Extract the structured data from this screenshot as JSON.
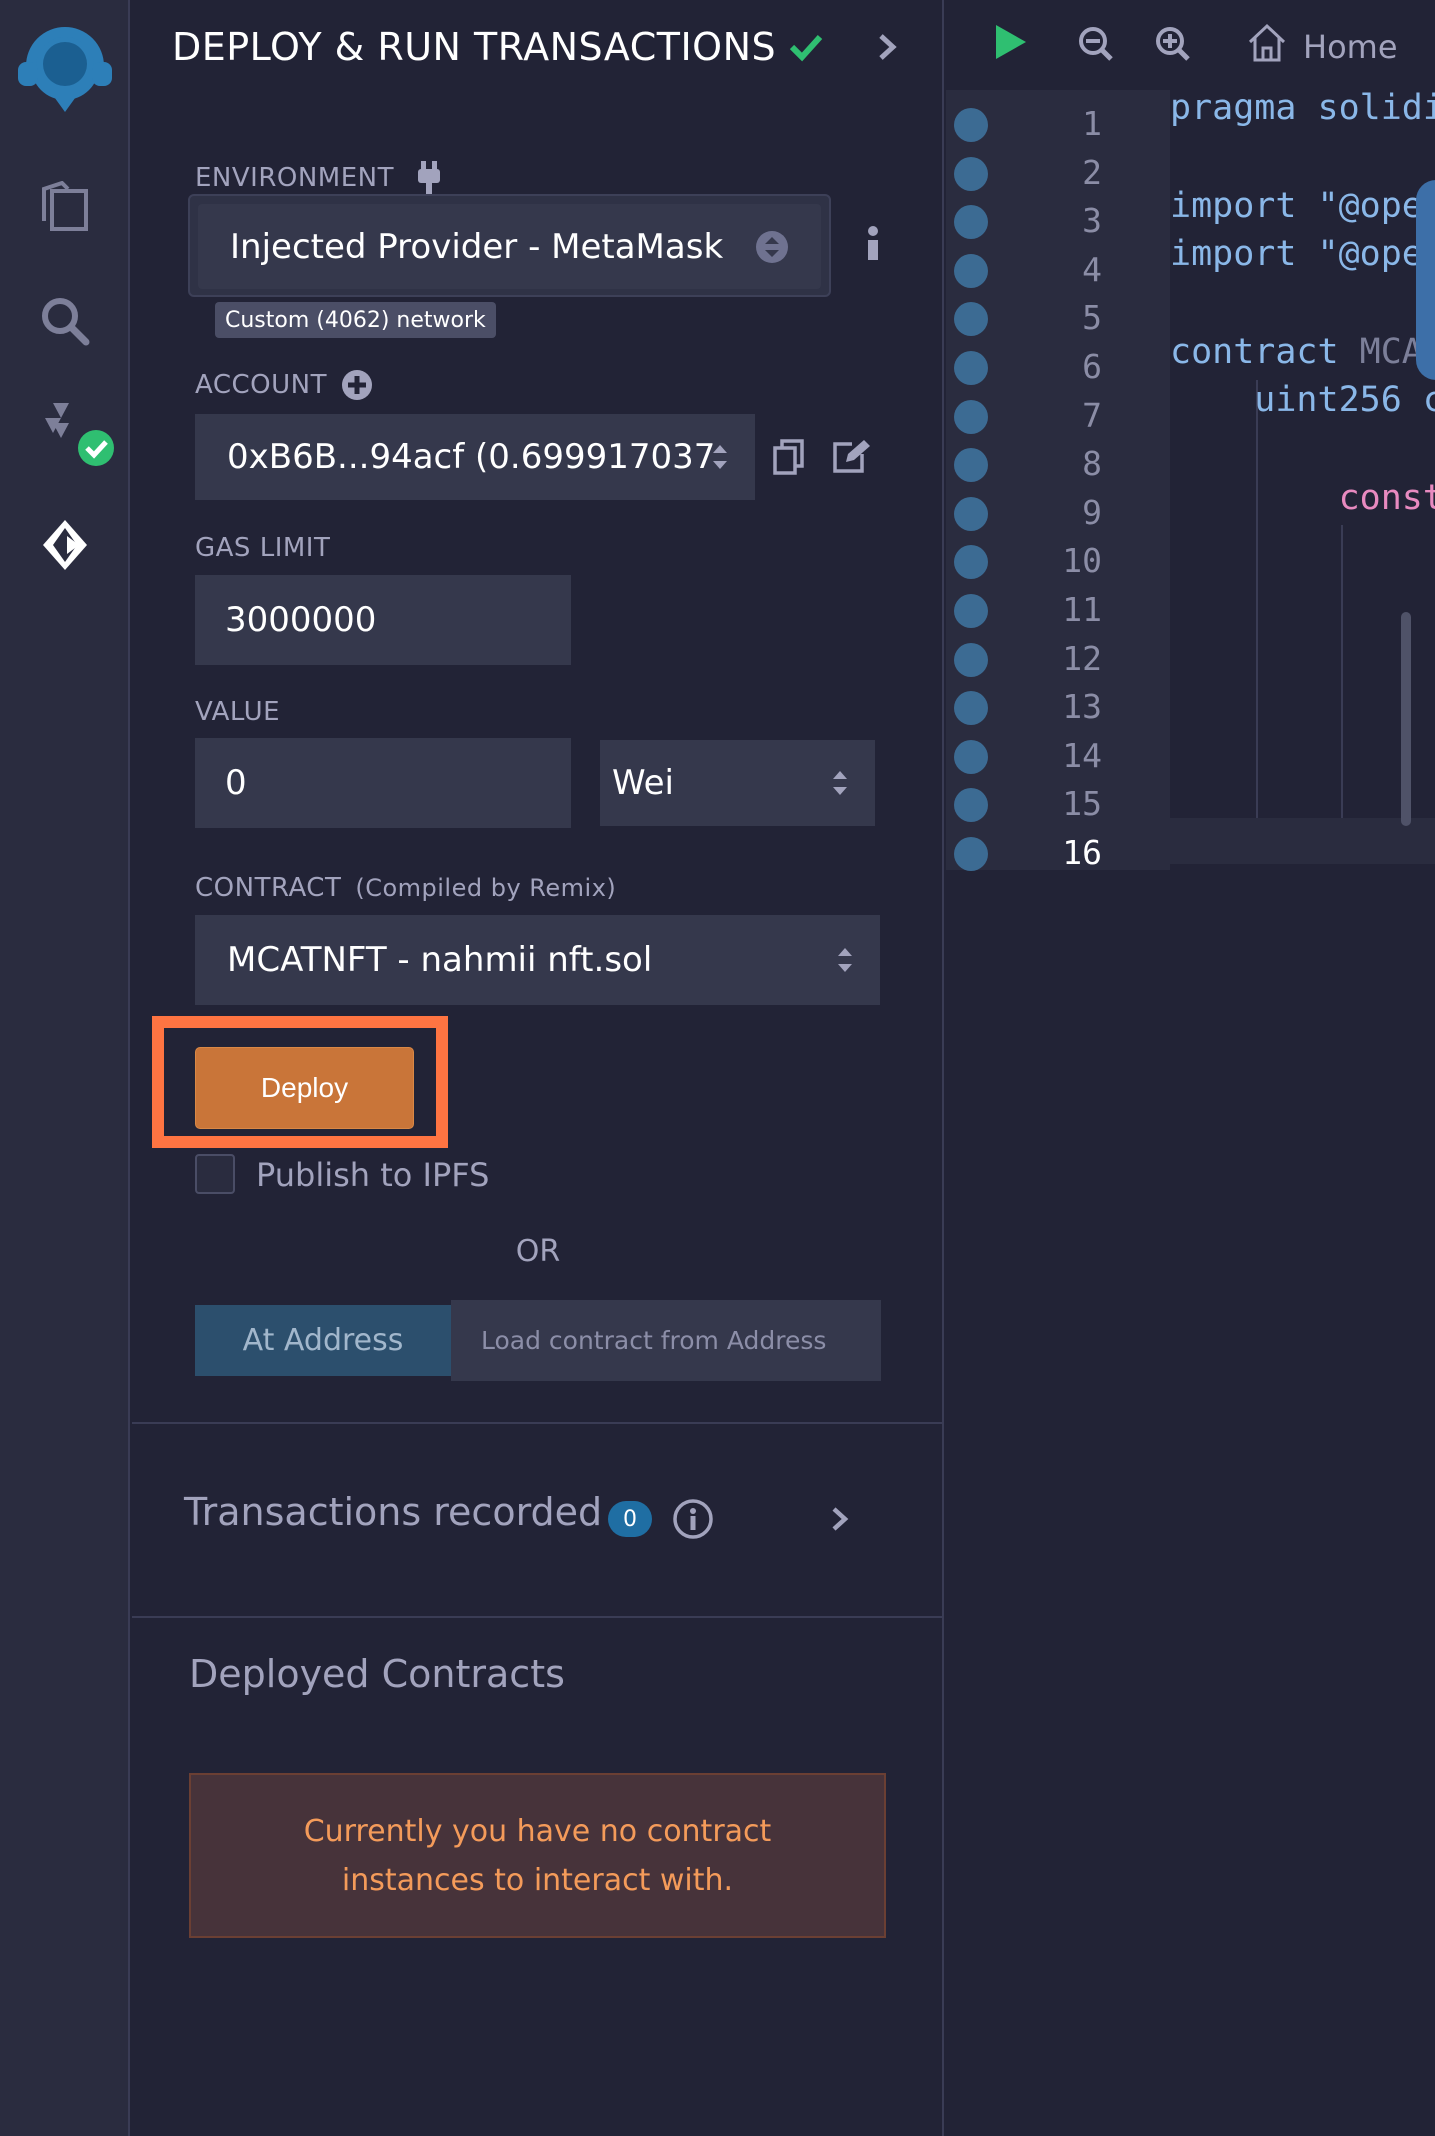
{
  "panel": {
    "title": "DEPLOY & RUN TRANSACTIONS",
    "environment": {
      "label": "ENVIRONMENT",
      "value": "Injected Provider - MetaMask",
      "network_tip": "Custom (4062) network"
    },
    "account": {
      "label": "ACCOUNT",
      "value": "0xB6B...94acf (0.699917037"
    },
    "gas_limit": {
      "label": "GAS LIMIT",
      "value": "3000000"
    },
    "value": {
      "label": "VALUE",
      "amount": "0",
      "unit": "Wei"
    },
    "contract": {
      "label": "CONTRACT",
      "sub_label": "(Compiled by Remix)",
      "value": "MCATNFT - nahmii nft.sol"
    },
    "deploy_label": "Deploy",
    "publish_label": "Publish to IPFS",
    "or_label": "OR",
    "at_address_label": "At Address",
    "address_placeholder": "Load contract from Address",
    "transactions": {
      "label": "Transactions recorded",
      "count": "0"
    },
    "deployed": {
      "label": "Deployed Contracts",
      "empty_line1": "Currently you have no contract",
      "empty_line2": "instances to interact with."
    }
  },
  "editor": {
    "home_label": "Home",
    "line_numbers": [
      "1",
      "2",
      "3",
      "4",
      "5",
      "6",
      "7",
      "8",
      "9",
      "10",
      "11",
      "12",
      "13",
      "14",
      "15",
      "16"
    ],
    "code": {
      "l1": "pragma solidi",
      "l3": "import \"@oper",
      "l4": "import \"@oper",
      "l6a": "contract ",
      "l6b": "MCAT",
      "l7": "    uint256 c",
      "l9": "        const"
    }
  },
  "colors": {
    "accent_orange": "#c97539",
    "highlight": "#ff7442",
    "check_green": "#2fbf71",
    "badge_blue": "#1f6ea3"
  }
}
